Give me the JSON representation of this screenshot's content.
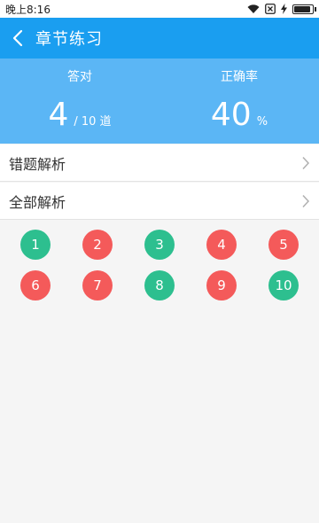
{
  "status_bar": {
    "time": "晚上8:16"
  },
  "header": {
    "title": "章节练习"
  },
  "stats": {
    "correct_label": "答对",
    "correct_value": "4",
    "correct_suffix": "/ 10 道",
    "rate_label": "正确率",
    "rate_value": "40",
    "rate_suffix": "%"
  },
  "menu": {
    "wrong_analysis": "错题解析",
    "all_analysis": "全部解析"
  },
  "questions": [
    {
      "num": "1",
      "status": "correct"
    },
    {
      "num": "2",
      "status": "wrong"
    },
    {
      "num": "3",
      "status": "correct"
    },
    {
      "num": "4",
      "status": "wrong"
    },
    {
      "num": "5",
      "status": "wrong"
    },
    {
      "num": "6",
      "status": "wrong"
    },
    {
      "num": "7",
      "status": "wrong"
    },
    {
      "num": "8",
      "status": "correct"
    },
    {
      "num": "9",
      "status": "wrong"
    },
    {
      "num": "10",
      "status": "correct"
    }
  ],
  "colors": {
    "appbar": "#1a9ef0",
    "stats_bg": "#5bb6f5",
    "correct": "#2dbf8f",
    "wrong": "#f45a5a"
  },
  "icons": {
    "wifi": "wifi-icon",
    "sim": "sim-no-signal-icon",
    "charging": "charging-bolt-icon",
    "battery": "battery-icon",
    "back": "chevron-left-icon",
    "row_arrow": "chevron-right-icon"
  },
  "battery_level": 0.95
}
